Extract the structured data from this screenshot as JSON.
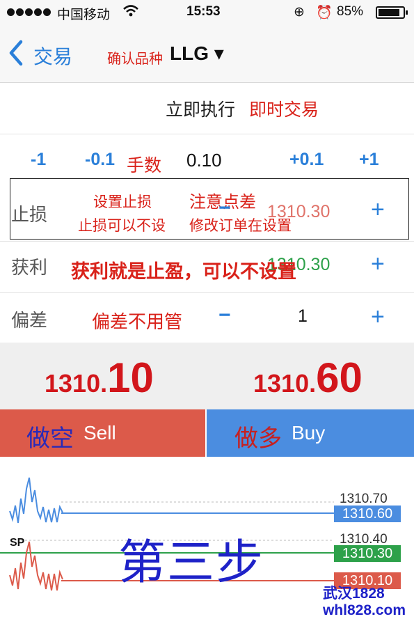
{
  "status_bar": {
    "carrier": "中国移动",
    "time": "15:53",
    "battery": "85%"
  },
  "nav": {
    "back_label": "交易",
    "symbol_note": "确认品种",
    "symbol": "LLG ▾"
  },
  "execution": {
    "label": "立即执行",
    "note": "即时交易"
  },
  "lot_row": {
    "minus1": "-1",
    "minus01": "-0.1",
    "note": "手数",
    "value": "0.10",
    "plus01": "+0.1",
    "plus1": "+1"
  },
  "stop_loss": {
    "label": "止损",
    "note1": "设置止损",
    "note2": "止损可以不设",
    "note3": "注意点差",
    "note4": "修改订单在设置",
    "minus": "−",
    "value": "1310.30",
    "plus": "+"
  },
  "take_profit": {
    "label": "获利",
    "note": "获利就是止盈，可以不设置",
    "value": "1310.30",
    "plus": "+"
  },
  "deviation": {
    "label": "偏差",
    "note": "偏差不用管",
    "minus": "−",
    "value": "1",
    "plus": "+"
  },
  "quotes": {
    "bid_small": "1310.",
    "bid_big": "10",
    "ask_small": "1310.",
    "ask_big": "60"
  },
  "buttons": {
    "sell_cn": "做空",
    "sell_en": "Sell",
    "buy_cn": "做多",
    "buy_en": "Buy"
  },
  "chart": {
    "level_top": "1310.70",
    "ask_tag": "1310.60",
    "level_mid": "1310.40",
    "tp_tag": "1310.30",
    "bid_tag": "1310.10",
    "sp_label": "SP"
  },
  "overlay": {
    "step_title": "第三步",
    "watermark_line1": "武汉1828",
    "watermark_line2": "whl828.com"
  },
  "colors": {
    "accent": "#2a7fd9",
    "annotation": "#d9221a",
    "sell": "#dc5a4a",
    "buy": "#4b8de0",
    "price": "#d2161b"
  }
}
